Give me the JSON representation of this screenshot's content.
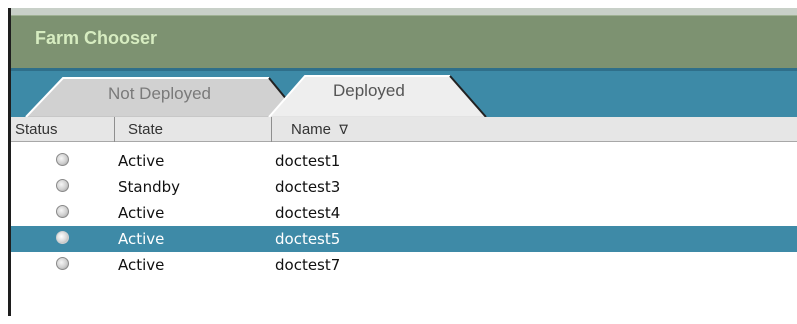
{
  "window": {
    "title": "Farm Chooser"
  },
  "tabs": [
    {
      "label": "Not Deployed",
      "active": false
    },
    {
      "label": "Deployed",
      "active": true
    }
  ],
  "table": {
    "columns": [
      {
        "label": "Status"
      },
      {
        "label": "State"
      },
      {
        "label": "Name",
        "sort_icon": "∇"
      }
    ],
    "rows": [
      {
        "status_icon": "status-indicator-icon",
        "state": "Active",
        "name": "doctest1",
        "selected": false
      },
      {
        "status_icon": "status-indicator-icon",
        "state": "Standby",
        "name": "doctest3",
        "selected": false
      },
      {
        "status_icon": "status-indicator-icon",
        "state": "Active",
        "name": "doctest4",
        "selected": false
      },
      {
        "status_icon": "status-indicator-icon",
        "state": "Active",
        "name": "doctest5",
        "selected": true
      },
      {
        "status_icon": "status-indicator-icon",
        "state": "Active",
        "name": "doctest7",
        "selected": false
      }
    ]
  },
  "colors": {
    "title_bar": "#7d9271",
    "title_text": "#d6ecc0",
    "tab_bar": "#3d8aa7",
    "selected_row": "#3e8aa7",
    "header": "#e6e6e6"
  }
}
